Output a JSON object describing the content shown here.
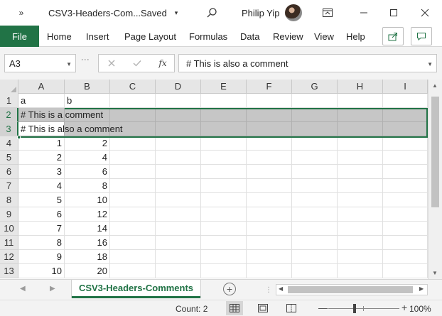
{
  "titlebar": {
    "qat_more": "»",
    "doc_title": "CSV3-Headers-Com...",
    "saved": "Saved",
    "user": "Philip Yip"
  },
  "ribbon": {
    "file": "File",
    "tabs": [
      "Home",
      "Insert",
      "Page Layout",
      "Formulas",
      "Data",
      "Review",
      "View",
      "Help"
    ]
  },
  "formula_bar": {
    "name_box": "A3",
    "content": "# This is also a comment"
  },
  "sheet": {
    "columns": [
      "A",
      "B",
      "C",
      "D",
      "E",
      "F",
      "G",
      "H",
      "I"
    ],
    "rows": [
      {
        "num": "1",
        "a": "a",
        "b": "b"
      },
      {
        "num": "2",
        "a": "# This is a comment",
        "b": ""
      },
      {
        "num": "3",
        "a": "# This is also a comment",
        "b": ""
      },
      {
        "num": "4",
        "a": "1",
        "b": "2"
      },
      {
        "num": "5",
        "a": "2",
        "b": "4"
      },
      {
        "num": "6",
        "a": "3",
        "b": "6"
      },
      {
        "num": "7",
        "a": "4",
        "b": "8"
      },
      {
        "num": "8",
        "a": "5",
        "b": "10"
      },
      {
        "num": "9",
        "a": "6",
        "b": "12"
      },
      {
        "num": "10",
        "a": "7",
        "b": "14"
      },
      {
        "num": "11",
        "a": "8",
        "b": "16"
      },
      {
        "num": "12",
        "a": "9",
        "b": "18"
      },
      {
        "num": "13",
        "a": "10",
        "b": "20"
      }
    ],
    "selected_rows": [
      "2",
      "3"
    ],
    "active_cell": "A3"
  },
  "sheet_tabs": {
    "active": "CSV3-Headers-Comments"
  },
  "status": {
    "count": "Count: 2",
    "zoom": "100%"
  },
  "colors": {
    "accent": "#217346",
    "selection": "#c6c6c6"
  }
}
